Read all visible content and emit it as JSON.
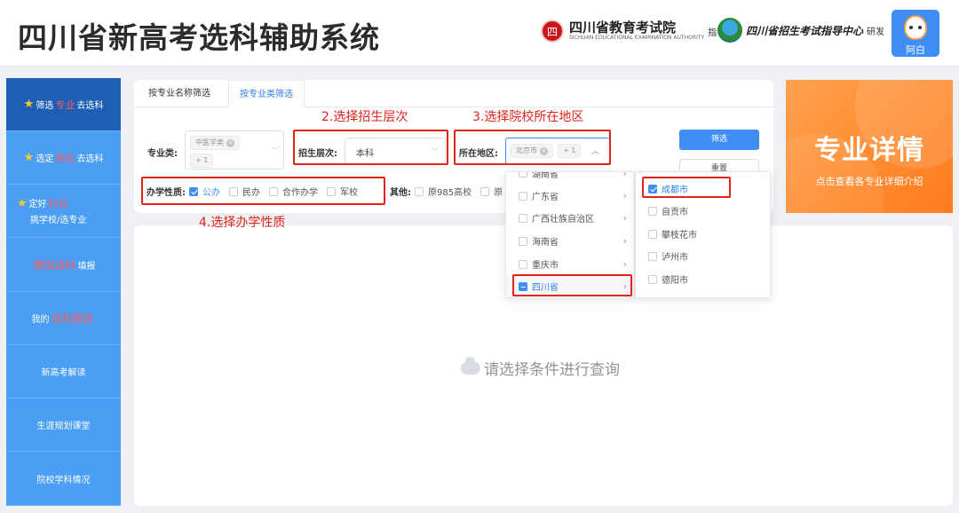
{
  "header": {
    "app_title": "四川省新高考选科辅助系统",
    "brand1_seal": "四",
    "brand1_name": "四川省教育考试院",
    "brand1_en": "SICHUAN EDUCATIONAL EXAMINATION AUTHORITY",
    "brand1_role": "指导",
    "brand2_name": "四川省招生考试指导中心",
    "brand2_role": "研发",
    "avatar_name": "阿白"
  },
  "sidebar": {
    "items": [
      {
        "pre": "筛选",
        "hl": "专业",
        "post": "去选科"
      },
      {
        "pre": "选定",
        "hl": "院校",
        "post": "去选科"
      },
      {
        "pre": "定好",
        "hl": "科目",
        "line2": "挑学校/选专业"
      },
      {
        "hl": "模拟选科",
        "post": "填报"
      },
      {
        "pre": "我的",
        "hl": "选科报告"
      },
      {
        "label": "新高考解读"
      },
      {
        "label": "生涯规划课堂"
      },
      {
        "label": "院校学科情况"
      }
    ]
  },
  "filter": {
    "tabs": [
      "按专业名称筛选",
      "按专业类筛选"
    ],
    "major_type_label": "专业类:",
    "major_tag": "中医学类",
    "major_more": "+ 1",
    "level_label": "招生层次:",
    "level_value": "本科",
    "region_label": "所在地区:",
    "region_tag": "北京市",
    "region_more": "+ 1",
    "btn_filter": "筛选",
    "btn_reset": "重置",
    "nature_label": "办学性质:",
    "nature_options": [
      "公办",
      "民办",
      "合作办学",
      "军校"
    ],
    "other_label": "其他:",
    "other_options": [
      "原985高校",
      "原"
    ]
  },
  "annotations": {
    "a2": "2.选择招生层次",
    "a3": "3.选择院校所在地区",
    "a4": "4.选择办学性质"
  },
  "results": {
    "empty_text": "请选择条件进行查询"
  },
  "promo": {
    "title": "专业详情",
    "subtitle": "点击查看各专业详细介绍"
  },
  "dropdown": {
    "provinces": [
      "湖南省",
      "广东省",
      "广西壮族自治区",
      "海南省",
      "重庆市",
      "四川省"
    ],
    "cities": [
      "成都市",
      "自贡市",
      "攀枝花市",
      "泸州市",
      "德阳市"
    ]
  }
}
